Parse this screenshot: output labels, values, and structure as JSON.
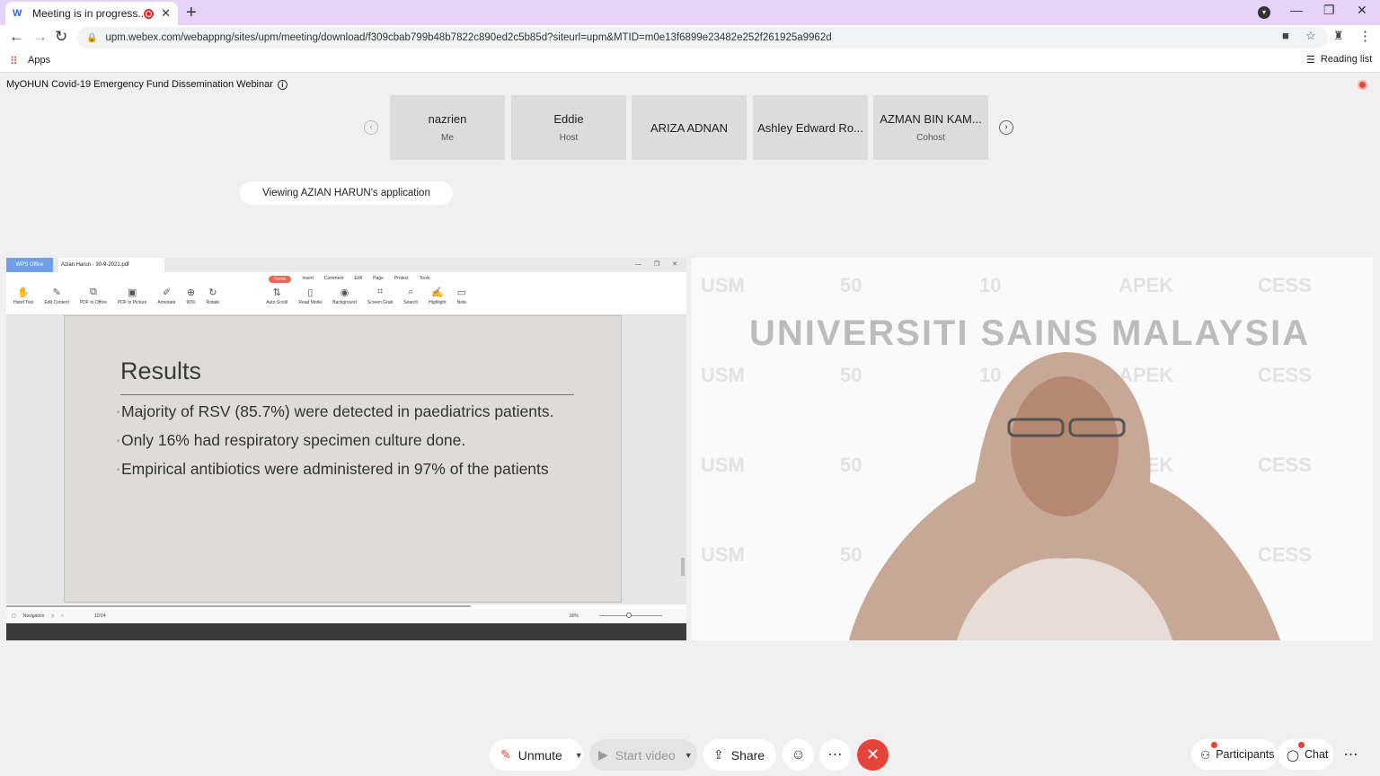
{
  "browser": {
    "tab_title": "Meeting is in progress...",
    "url": "upm.webex.com/webappng/sites/upm/meeting/download/f309cbab799b48b7822c890ed2c5b85d?siteurl=upm&MTID=m0e13f6899e23482e252f261925a9962d",
    "bookmark_apps": "Apps",
    "reading_list": "Reading list"
  },
  "meeting": {
    "title": "MyOHUN Covid-19 Emergency Fund Dissemination Webinar",
    "viewing_label": "Viewing AZIAN HARUN's application",
    "participants": [
      {
        "name": "nazrien",
        "role": "Me"
      },
      {
        "name": "Eddie",
        "role": "Host"
      },
      {
        "name": "ARIZA ADNAN",
        "role": ""
      },
      {
        "name": "Ashley Edward Ro...",
        "role": ""
      },
      {
        "name": "AZMAN BIN KAM...",
        "role": "Cohost"
      }
    ]
  },
  "shared_app": {
    "brand": "WPS Office",
    "doc_tab": "Azian Harun - 30-9-2021.pdf",
    "ribbon_tabs": [
      "Home",
      "Insert",
      "Comment",
      "Edit",
      "Page",
      "Protect",
      "Tools"
    ],
    "ribbon_tools": [
      "Hand Tool",
      "Edit Content",
      "PDF to Office",
      "PDF to Picture",
      "Annotate",
      "90%",
      "Rotate",
      "Auto Scroll",
      "Read Mode",
      "Background",
      "Screen Grab",
      "Search",
      "Highlight",
      "Note"
    ],
    "zoom": "90%",
    "page_indicator": "10/14",
    "status_zoom": "90%",
    "navigation_label": "Navigation",
    "slide": {
      "title": "Results",
      "bullets": [
        "Majority of RSV (85.7%) were detected in paediatrics patients.",
        "Only 16% had respiratory specimen culture done.",
        "Empirical antibiotics were administered in 97% of the patients"
      ]
    }
  },
  "video": {
    "backdrop_title": "UNIVERSITI SAINS MALAYSIA",
    "backdrop_logos": [
      "USM",
      "50",
      "10",
      "APEK",
      "CESS"
    ]
  },
  "controls": {
    "unmute": "Unmute",
    "start_video": "Start video",
    "share": "Share",
    "participants": "Participants",
    "chat": "Chat"
  },
  "colors": {
    "tabbar": "#e5d4f7",
    "leave": "#e5443b",
    "wps_accent": "#e96757"
  }
}
